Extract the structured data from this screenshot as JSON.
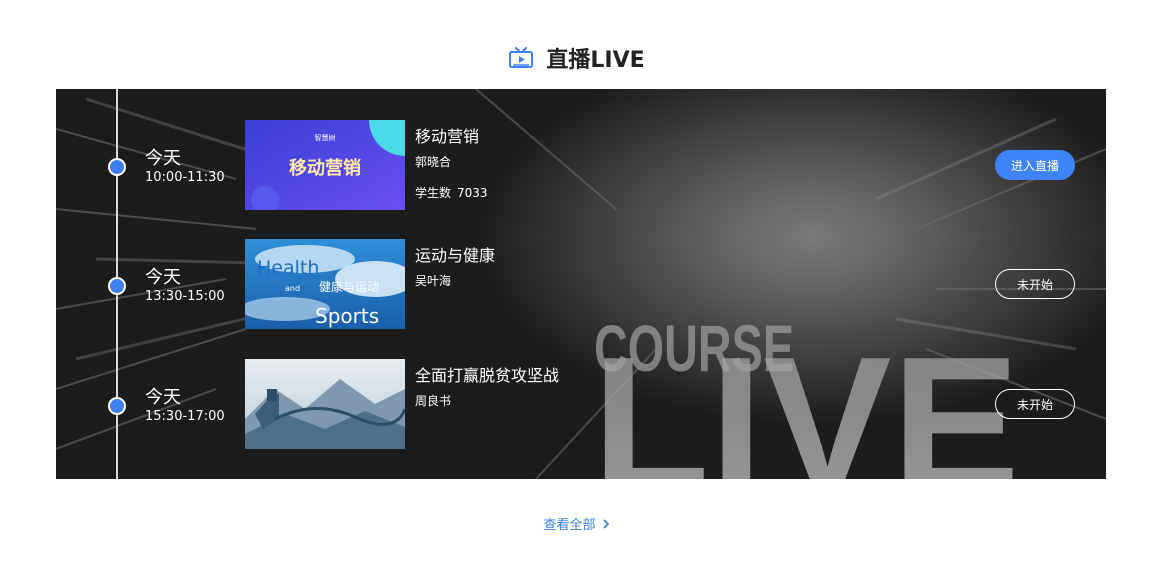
{
  "header": {
    "icon": "tv-icon",
    "title": "直播LIVE"
  },
  "banner": {
    "watermark_top": "COURSE",
    "watermark_bottom": "LIVE"
  },
  "live_items": [
    {
      "day": "今天",
      "time": "10:00-11:30",
      "thumb_brand": "智慧树",
      "thumb_text": "移动营销",
      "title": "移动营销",
      "teacher": "郭晓合",
      "students_label": "学生数",
      "students_count": "7033",
      "button": "进入直播",
      "button_style": "primary"
    },
    {
      "day": "今天",
      "time": "13:30-15:00",
      "thumb_text_1": "Health",
      "thumb_text_2": "and",
      "thumb_text_3": "健康与运动",
      "thumb_text_4": "Sports",
      "title": "运动与健康",
      "teacher": "吴叶海",
      "button": "未开始",
      "button_style": "outline"
    },
    {
      "day": "今天",
      "time": "15:30-17:00",
      "title": "全面打赢脱贫攻坚战",
      "teacher": "周良书",
      "button": "未开始",
      "button_style": "outline"
    }
  ],
  "footer": {
    "view_all": "查看全部",
    "icon": "chevron-right-icon"
  },
  "colors": {
    "accent": "#3f83f8",
    "link": "#3d7fe0",
    "title": "#222222"
  }
}
